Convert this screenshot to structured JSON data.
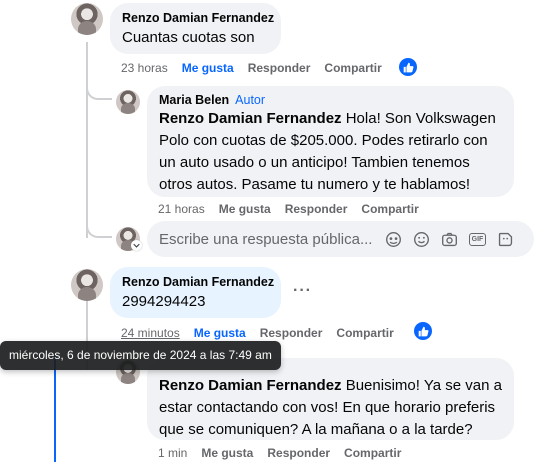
{
  "comments": [
    {
      "author": "Renzo Damian Fernandez",
      "text": "Cuantas cuotas son",
      "time": "23 horas",
      "like_label": "Me gusta",
      "reply_label": "Responder",
      "share_label": "Compartir"
    },
    {
      "author": "Maria Belen",
      "badge": "Autor",
      "mention": "Renzo Damian Fernandez",
      "text": " Hola! Son Volkswagen Polo con cuotas de $205.000. Podes retirarlo con un auto usado o un anticipo! Tambien tenemos otros autos. Pasame tu numero y te hablamos!",
      "time": "21 horas",
      "like_label": "Me gusta",
      "reply_label": "Responder",
      "share_label": "Compartir"
    },
    {
      "author": "Renzo Damian Fernandez",
      "text": "2994294423",
      "time": "24 minutos",
      "like_label": "Me gusta",
      "reply_label": "Responder",
      "share_label": "Compartir",
      "more_label": "···"
    },
    {
      "mention": "Renzo Damian Fernandez",
      "text": " Buenisimo! Ya se van a estar contactando con vos! En que horario preferis que se comuniquen? A la mañana o a la tarde?",
      "time": "1 min",
      "like_label": "Me gusta",
      "reply_label": "Responder",
      "share_label": "Compartir"
    }
  ],
  "reply_box": {
    "placeholder": "Escribe una respuesta pública...",
    "icons": [
      "sticker-avatar-icon",
      "emoji-icon",
      "camera-icon",
      "gif-icon",
      "sticker-icon"
    ],
    "gif_label": "GIF"
  },
  "tooltip": "miércoles, 6 de noviembre de 2024 a las 7:49 am",
  "colors": {
    "accent": "#0866ff",
    "bubble": "#f0f2f5",
    "bubble_highlight": "#e7f3ff",
    "meta": "#65676b"
  }
}
